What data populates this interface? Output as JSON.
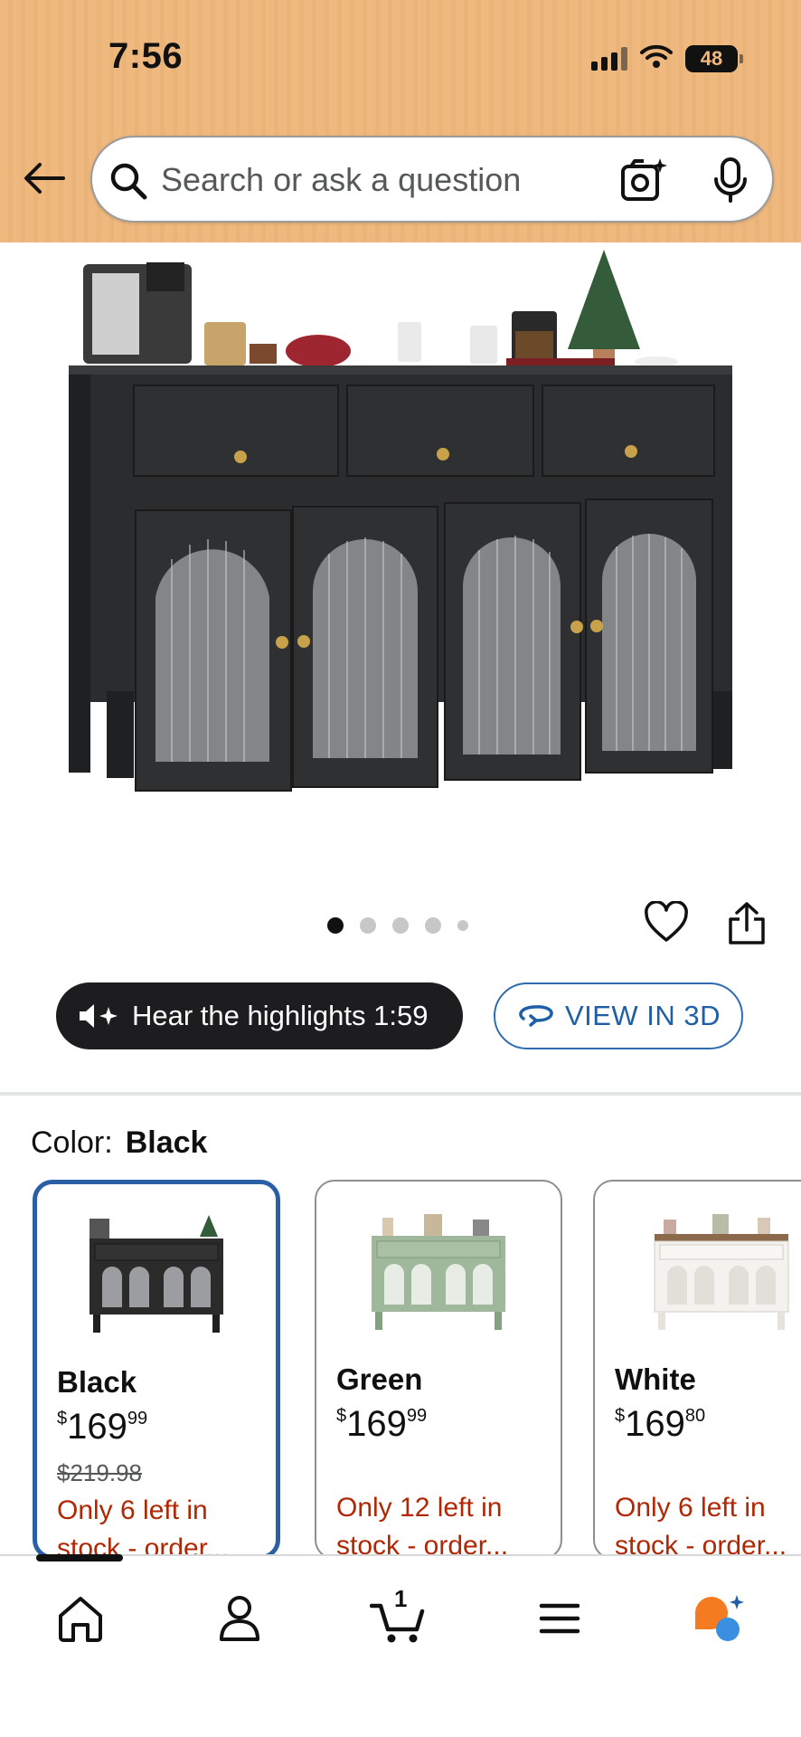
{
  "status_bar": {
    "time": "7:56",
    "battery": "48"
  },
  "search": {
    "placeholder": "Search or ask a question"
  },
  "carousel": {
    "dot_count": 5,
    "active_index": 0
  },
  "actions": {
    "hear_label": "Hear the highlights 1:59",
    "view3d_label": "VIEW IN 3D"
  },
  "color": {
    "label": "Color:",
    "selected": "Black"
  },
  "swatches": [
    {
      "name": "Black",
      "currency": "$",
      "price_whole": "169",
      "price_frac": "99",
      "list_price": "$219.98",
      "stock_line1": "Only 6 left in",
      "stock_line2": "stock - order...",
      "color_hex": "#2b2b2b"
    },
    {
      "name": "Green",
      "currency": "$",
      "price_whole": "169",
      "price_frac": "99",
      "stock_line1": "Only 12 left in",
      "stock_line2": "stock - order...",
      "color_hex": "#9fb79b"
    },
    {
      "name": "White",
      "currency": "$",
      "price_whole": "169",
      "price_frac": "80",
      "stock_line1": "Only 6 left in",
      "stock_line2": "stock - order...",
      "color_hex": "#f4f2ee"
    }
  ],
  "bottom_nav": {
    "cart_count": "1",
    "items": [
      "home-icon",
      "account-icon",
      "cart-icon",
      "menu-icon",
      "rufus-icon"
    ]
  },
  "colors": {
    "header_bg": "#efb87e",
    "accent_blue": "#2a5fa5",
    "stock_red": "#b12704",
    "rufus_orange": "#f47b20",
    "rufus_blue": "#3b8fe0"
  }
}
